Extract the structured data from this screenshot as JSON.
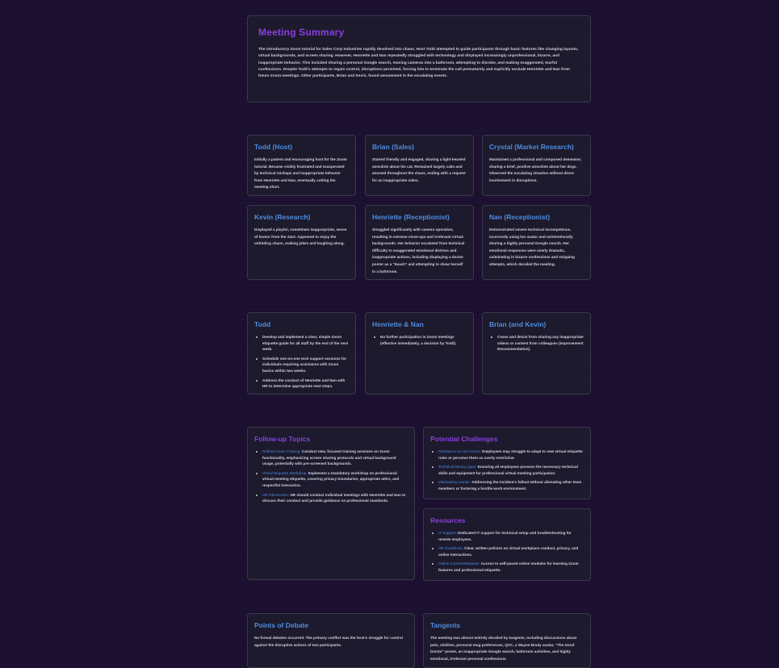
{
  "summary": {
    "title": "Meeting Summary",
    "text": "The introductory Zoom tutorial for Sales Corp Industries rapidly devolved into chaos. Host Todd attempted to guide participants through basic features like changing layouts, virtual backgrounds, and screen sharing. However, Henriette and Nan repeatedly struggled with technology and displayed increasingly unprofessional, bizarre, and inappropriate behavior. This included sharing a personal Google search, moving cameras into a bathroom, attempting to disrobe, and making exaggerated, tearful confessions. Despite Todd's attempts to regain control, disruptions persisted, forcing him to terminate the call prematurely and explicitly exclude Henriette and Nan from future Zoom meetings. Other participants, Brian and Kevin, found amusement in the escalating events."
  },
  "participants": [
    {
      "name": "Todd (Host)",
      "desc": "Initially a patient and encouraging host for the Zoom tutorial. Became visibly frustrated and exasperated by technical mishaps and inappropriate behavior from Henriette and Nan, eventually cutting the meeting short."
    },
    {
      "name": "Brian (Sales)",
      "desc": "Started friendly and engaged, sharing a light-hearted anecdote about his cat. Remained largely calm and amused throughout the chaos, ending with a request for an inappropriate video."
    },
    {
      "name": "Crystal (Market Research)",
      "desc": "Maintained a professional and composed demeanor, sharing a brief, positive anecdote about her dogs. Observed the escalating situation without direct involvement in disruptions."
    },
    {
      "name": "Kevin (Research)",
      "desc": "Displayed a playful, sometimes inappropriate, sense of humor from the start. Appeared to enjoy the unfolding chaos, making jokes and laughing along."
    },
    {
      "name": "Henriette (Receptionist)",
      "desc": "Struggled significantly with camera operation, resulting in extreme close-ups and irrelevant virtual backgrounds. Her behavior escalated from technical difficulty to exaggerated emotional distress and inappropriate actions, including displaying a doctor poster as a \"beach\" and attempting to show herself in a bathroom."
    },
    {
      "name": "Nan (Receptionist)",
      "desc": "Demonstrated severe technical incompetence, incorrectly using her avatar and unintentionally sharing a highly personal Google search. Her emotional responses were overly dramatic, culminating in bizarre confessions and stripping attempts, which derailed the meeting."
    }
  ],
  "actions": [
    {
      "name": "Todd",
      "items": [
        "Develop and implement a clear, simple Zoom etiquette guide for all staff by the end of the next week.",
        "Schedule one-on-one tech support sessions for individuals requiring assistance with Zoom basics within two weeks.",
        "Address the conduct of Henriette and Nan with HR to determine appropriate next steps."
      ]
    },
    {
      "name": "Henriette & Nan",
      "items": [
        "No further participation in Zoom meetings (effective immediately, a decision by Todd)."
      ]
    },
    {
      "name": "Brian (and Kevin)",
      "items": [
        "Cease and desist from sharing any inappropriate videos or content from colleagues (Improvement Recommendation)."
      ]
    }
  ],
  "followup": {
    "title": "Follow-up Topics",
    "items": [
      {
        "label": "Refined Zoom Training:",
        "text": " Conduct new, focused training sessions on Zoom functionality, emphasizing screen sharing protocols and virtual background usage, potentially with pre-screened backgrounds."
      },
      {
        "label": "Virtual Etiquette Workshop:",
        "text": " Implement a mandatory workshop on professional virtual meeting etiquette, covering privacy boundaries, appropriate attire, and respectful interaction."
      },
      {
        "label": "HR Intervention:",
        "text": " HR should conduct individual meetings with Henriette and Nan to discuss their conduct and provide guidance on professional standards."
      }
    ]
  },
  "challenges": {
    "title": "Potential Challenges",
    "items": [
      {
        "label": "Resistance to new norms:",
        "text": " Employees may struggle to adapt to new virtual etiquette rules or perceive them as overly restrictive."
      },
      {
        "label": "Technical literacy gaps:",
        "text": " Ensuring all employees possess the necessary technical skills and equipment for professional virtual meeting participation."
      },
      {
        "label": "Maintaining morale:",
        "text": " Addressing the incident's fallout without alienating other team members or fostering a hostile work environment."
      }
    ]
  },
  "resources": {
    "title": "Resources",
    "items": [
      {
        "label": "IT Support:",
        "text": " Dedicated IT support for technical setup and troubleshooting for remote employees."
      },
      {
        "label": "HR Guidelines:",
        "text": " Clear, written policies on virtual workplace conduct, privacy, and online interactions."
      },
      {
        "label": "Online Courses/Modules:",
        "text": " Access to self-paced online modules for learning Zoom features and professional etiquette."
      }
    ]
  },
  "debate": {
    "title": "Points of Debate",
    "text": "No formal debates occurred. The primary conflict was the host's struggle for control against the disruptive actions of two participants."
  },
  "tangents": {
    "title": "Tangents",
    "text": "The meeting was almost entirely derailed by tangents, including discussions about pets, children, personal mug preferences, QVC, a Wayne Brady avatar, \"The Good Doctor\" poster, an inappropriate Google search, bathroom activities, and highly emotional, irrelevant personal confessions."
  },
  "colors": {
    "background": "#1b1030",
    "card": "#1c1a2c",
    "accent_purple": "#8a3fe0",
    "accent_blue": "#4f8de0"
  }
}
